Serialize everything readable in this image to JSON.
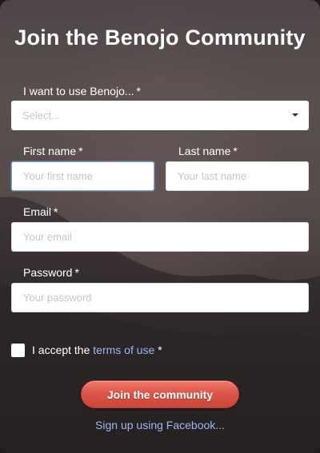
{
  "form": {
    "title": "Join the Benojo Community",
    "use_label": "I want to use Benojo...",
    "use_value": "Select...",
    "first_name_label": "First name",
    "first_name_placeholder": "Your first name",
    "last_name_label": "Last name",
    "last_name_placeholder": "Your last name",
    "email_label": "Email",
    "email_placeholder": "Your email",
    "password_label": "Password",
    "password_placeholder": "Your password",
    "required_marker": "*",
    "accept_prefix": "I accept the",
    "terms_link": "terms of use",
    "submit_label": "Join the community",
    "facebook_link": "Sign up using Facebook..."
  },
  "colors": {
    "link": "#9db6f2",
    "button": "#dd5548",
    "focus_border": "#7aa7d6"
  }
}
